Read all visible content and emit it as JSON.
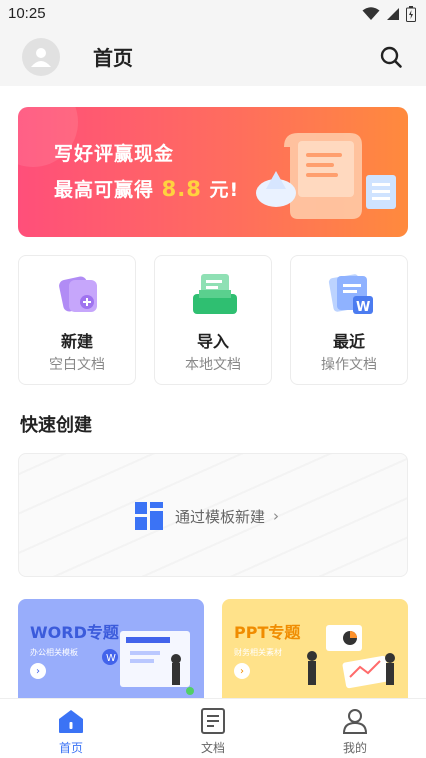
{
  "status_bar": {
    "time": "10:25",
    "icons": [
      "wifi-icon",
      "signal-icon",
      "battery-icon"
    ]
  },
  "header": {
    "title": "首页",
    "avatar_icon": "user-avatar-icon",
    "search_icon": "search-icon"
  },
  "banner": {
    "title": "写好评赢现金",
    "subtitle_prefix": "最高可赢得 ",
    "amount": "8.8",
    "subtitle_suffix": " 元!",
    "colors": {
      "start": "#ff4f7a",
      "end": "#ff8a3d",
      "amount": "#ffd23f"
    }
  },
  "actions": [
    {
      "label": "新建",
      "sub": "空白文档",
      "icon": "new-document-icon"
    },
    {
      "label": "导入",
      "sub": "本地文档",
      "icon": "import-document-icon"
    },
    {
      "label": "最近",
      "sub": "操作文档",
      "icon": "recent-document-icon"
    }
  ],
  "quick_create": {
    "title": "快速创建",
    "template_label": "通过模板新建",
    "template_icon": "grid-template-icon"
  },
  "topics": [
    {
      "title": "WORD专题",
      "sub": "办公相关模板",
      "color": "#98adfb"
    },
    {
      "title": "PPT专题",
      "sub": "财务相关素材",
      "color": "#ffe28a"
    }
  ],
  "tab_bar": {
    "active_color": "#3b73f5",
    "items": [
      {
        "label": "首页",
        "icon": "home-icon",
        "active": true
      },
      {
        "label": "文档",
        "icon": "document-icon",
        "active": false
      },
      {
        "label": "我的",
        "icon": "profile-icon",
        "active": false
      }
    ]
  }
}
